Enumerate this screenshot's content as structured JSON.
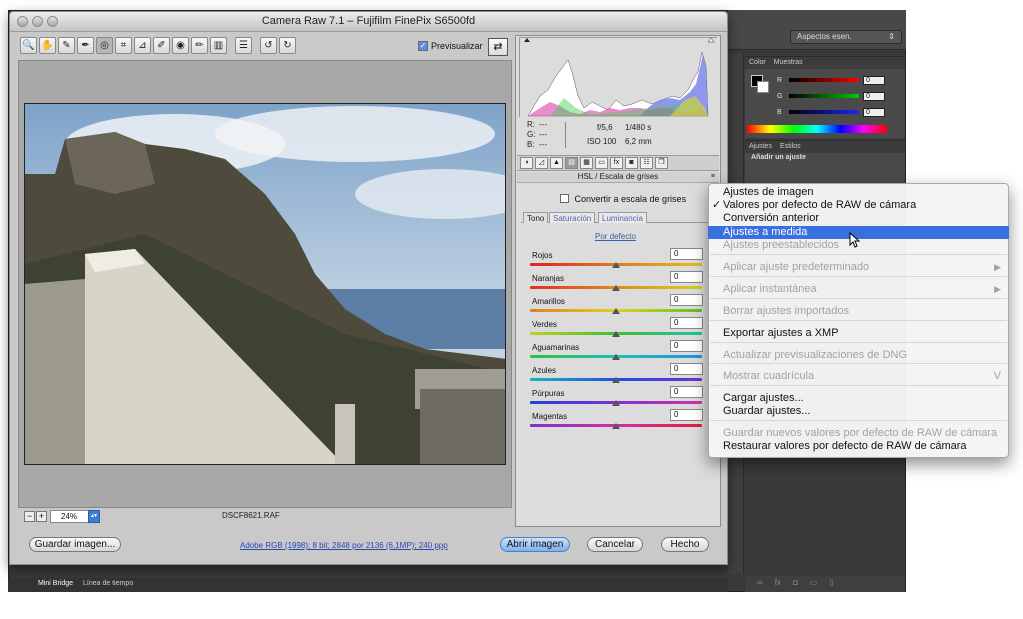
{
  "window": {
    "title": "Camera Raw 7.1 –  Fujifilm FinePix S6500fd"
  },
  "photoshop": {
    "workspace": "Aspectos esen.",
    "color_tabs": [
      "Color",
      "Muestras"
    ],
    "color_channels": [
      {
        "label": "R",
        "value": "0"
      },
      {
        "label": "G",
        "value": "0"
      },
      {
        "label": "B",
        "value": "0"
      }
    ],
    "adjust_tabs": [
      "Ajustes",
      "Estilos"
    ],
    "adjust_title": "Añadir un ajuste",
    "bottom_tabs": [
      "Mini Bridge",
      "Línea de tiempo"
    ]
  },
  "toolbar": {
    "tools": [
      {
        "name": "zoom-tool-icon",
        "glyph": "🔍"
      },
      {
        "name": "hand-tool-icon",
        "glyph": "✋"
      },
      {
        "name": "white-balance-tool-icon",
        "glyph": "✎"
      },
      {
        "name": "color-sampler-tool-icon",
        "glyph": "✒"
      },
      {
        "name": "targeted-adjustment-tool-icon",
        "glyph": "◎"
      },
      {
        "name": "crop-tool-icon",
        "glyph": "⌗"
      },
      {
        "name": "straighten-tool-icon",
        "glyph": "⊿"
      },
      {
        "name": "spot-removal-tool-icon",
        "glyph": "✐"
      },
      {
        "name": "red-eye-tool-icon",
        "glyph": "◉"
      },
      {
        "name": "adjustment-brush-icon",
        "glyph": "✏"
      },
      {
        "name": "graduated-filter-icon",
        "glyph": "▥"
      },
      {
        "name": "preferences-icon",
        "glyph": "☰"
      },
      {
        "name": "rotate-ccw-icon",
        "glyph": "↺"
      },
      {
        "name": "rotate-cw-icon",
        "glyph": "↻"
      }
    ],
    "preview_label": "Previsualizar",
    "preview_checked": true
  },
  "footer": {
    "zoom": "24%",
    "filename": "DSCF8621.RAF",
    "save_label": "Guardar imagen...",
    "workflow_link": "Adobe RGB (1998); 8 bit; 2848 por 2136 (6,1MP); 240 ppp",
    "open_label": "Abrir imagen",
    "cancel_label": "Cancelar",
    "done_label": "Hecho"
  },
  "info": {
    "r_label": "R:",
    "g_label": "G:",
    "b_label": "B:",
    "r_val": "---",
    "g_val": "---",
    "b_val": "---",
    "aperture": "f/5,6",
    "shutter": "1/480 s",
    "iso": "ISO 100",
    "focal": "6,2 mm"
  },
  "panel": {
    "title": "HSL / Escala de grises",
    "grayscale_label": "Convertir a escala de grises",
    "grayscale_checked": false,
    "subtabs": [
      "Tono",
      "Saturación",
      "Luminancia"
    ],
    "default_link": "Por defecto",
    "sliders": [
      {
        "label": "Rojos",
        "value": "0",
        "colors": [
          "#e02020",
          "#e07a20",
          "#e0c020"
        ]
      },
      {
        "label": "Naranjas",
        "value": "0",
        "colors": [
          "#e03020",
          "#e08a20",
          "#d0d020"
        ]
      },
      {
        "label": "Amarillos",
        "value": "0",
        "colors": [
          "#e08020",
          "#e0d020",
          "#60c020"
        ]
      },
      {
        "label": "Verdes",
        "value": "0",
        "colors": [
          "#c0d020",
          "#40c030",
          "#20c0a0"
        ]
      },
      {
        "label": "Aguamarinas",
        "value": "0",
        "colors": [
          "#30c040",
          "#20c0b0",
          "#2090e0"
        ]
      },
      {
        "label": "Azules",
        "value": "0",
        "colors": [
          "#20b0c0",
          "#2050e0",
          "#7030d0"
        ]
      },
      {
        "label": "Púrpuras",
        "value": "0",
        "colors": [
          "#2040e0",
          "#8030d0",
          "#d030b0"
        ]
      },
      {
        "label": "Magentas",
        "value": "0",
        "colors": [
          "#8030d0",
          "#d030a0",
          "#e02040"
        ]
      }
    ]
  },
  "menu": {
    "items": [
      {
        "label": "Ajustes de imagen",
        "disabled": false
      },
      {
        "label": "Valores por defecto de RAW de cámara",
        "disabled": false,
        "checked": true
      },
      {
        "label": "Conversión anterior",
        "disabled": false
      },
      {
        "label": "Ajustes a medida",
        "disabled": false,
        "highlighted": true
      },
      {
        "label": "Ajustes preestablecidos",
        "disabled": true
      },
      {
        "label": "Aplicar ajuste predeterminado",
        "disabled": true,
        "submenu": true
      },
      {
        "label": "Aplicar instantánea",
        "disabled": true,
        "submenu": true
      },
      {
        "label": "Borrar ajustes importados",
        "disabled": true
      },
      {
        "label": "Exportar ajustes a XMP",
        "disabled": false
      },
      {
        "label": "Actualizar previsualizaciones de DNG",
        "disabled": true
      },
      {
        "label": "Mostrar cuadrícula",
        "disabled": true,
        "shortcut": "V"
      },
      {
        "label": "Cargar ajustes...",
        "disabled": false
      },
      {
        "label": "Guardar ajustes...",
        "disabled": false
      },
      {
        "label": "Guardar nuevos valores por defecto de RAW de cámara",
        "disabled": true
      },
      {
        "label": "Restaurar valores por defecto de RAW de cámara",
        "disabled": false
      }
    ]
  }
}
